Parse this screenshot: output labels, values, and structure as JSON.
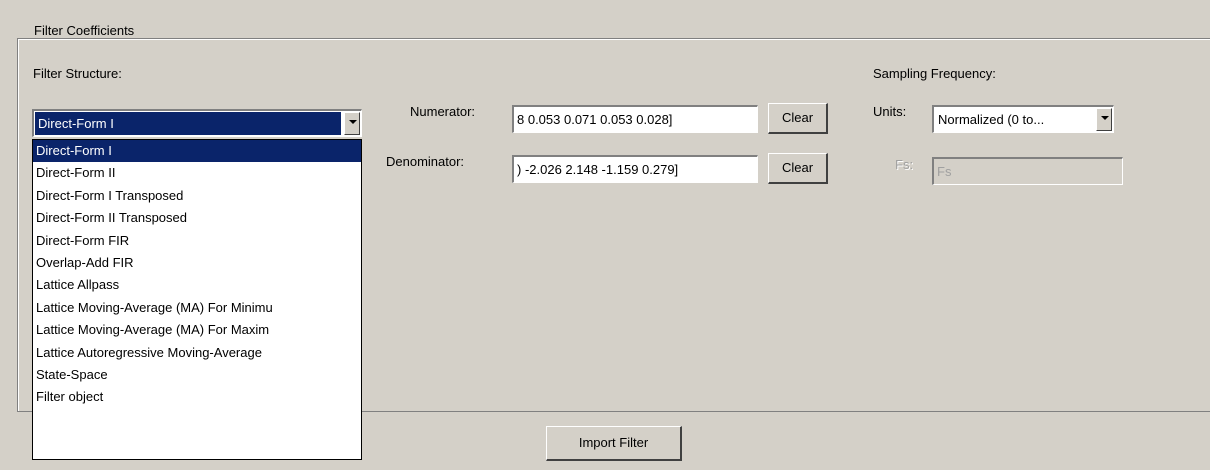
{
  "group_title": "Filter Coefficients",
  "filter_structure": {
    "label": "Filter Structure:",
    "selected": "Direct-Form I",
    "options": [
      "Direct-Form I",
      "Direct-Form II",
      "Direct-Form I Transposed",
      "Direct-Form II Transposed",
      "Direct-Form FIR",
      "Overlap-Add FIR",
      "Lattice Allpass",
      "Lattice Moving-Average (MA) For Minimu",
      "Lattice Moving-Average (MA) For Maxim",
      "Lattice Autoregressive Moving-Average",
      "State-Space",
      "Filter object"
    ]
  },
  "numerator": {
    "label": "Numerator:",
    "value": "8  0.053 0.071  0.053 0.028]",
    "clear_label": "Clear"
  },
  "denominator": {
    "label": "Denominator:",
    "value": ") -2.026 2.148 -1.159 0.279]",
    "clear_label": "Clear"
  },
  "sampling": {
    "title": "Sampling Frequency:",
    "units_label": "Units:",
    "units_value": "Normalized (0 to...",
    "fs_label": "Fs:",
    "fs_value": "Fs"
  },
  "import_button_label": "Import Filter"
}
